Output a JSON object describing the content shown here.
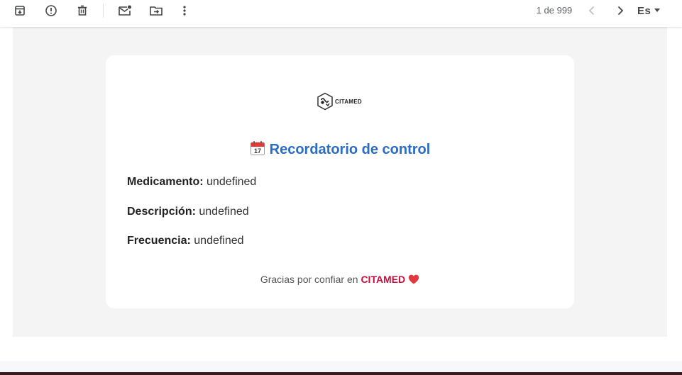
{
  "toolbar": {
    "icons": [
      "archive-icon",
      "report-spam-icon",
      "delete-icon",
      "mark-unread-icon",
      "move-to-icon",
      "more-options-icon"
    ],
    "pager": {
      "text": "1 de 999",
      "prev_icon": "chevron-left-icon",
      "next_icon": "chevron-right-icon"
    },
    "language": {
      "label": "Es",
      "dropdown_icon": "caret-down-icon"
    }
  },
  "email": {
    "logo_text": "CITAMED",
    "title_emoji": "calendar-icon",
    "title": "Recordatorio de control",
    "fields": [
      {
        "label": "Medicamento:",
        "value": "undefined"
      },
      {
        "label": "Descripción:",
        "value": "undefined"
      },
      {
        "label": "Frecuencia:",
        "value": "undefined"
      }
    ],
    "footer_text": "Gracias por confiar en",
    "footer_brand": "CITAMED",
    "footer_icon": "heart-icon",
    "colors": {
      "title": "#2b6cc4",
      "brand": "#c8103e",
      "heart": "#e0393e",
      "background": "#f4f4f4"
    }
  }
}
